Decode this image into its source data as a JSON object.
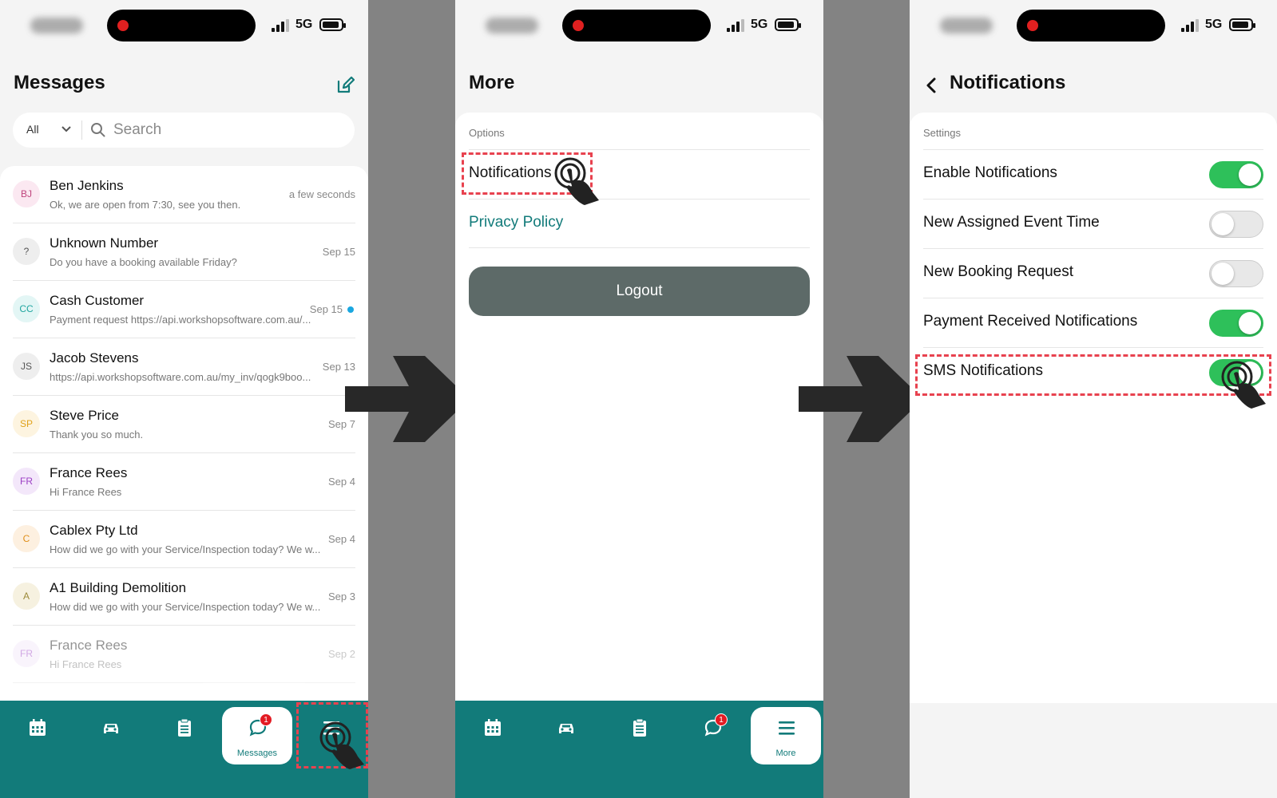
{
  "colors": {
    "teal": "#127b7a",
    "toggle_on": "#2ec05a",
    "highlight": "#e8424f",
    "badge": "#e31b23"
  },
  "status_bar": {
    "network": "5G"
  },
  "panel1": {
    "title": "Messages",
    "filter": "All",
    "search_placeholder": "Search",
    "messages": [
      {
        "initials": "BJ",
        "name": "Ben Jenkins",
        "preview": "Ok, we are open from 7:30, see you then.",
        "date": "a few seconds",
        "avatar_color": "#c0467e",
        "avatar_bg": "#fbe8f1"
      },
      {
        "initials": "?",
        "name": "Unknown Number",
        "preview": "Do you have a booking available Friday?",
        "date": "Sep 15",
        "avatar_color": "#555555",
        "avatar_bg": "#eeeeee"
      },
      {
        "initials": "CC",
        "name": "Cash Customer",
        "preview": "Payment request https://api.workshopsoftware.com.au/...",
        "date": "Sep 15",
        "avatar_color": "#21a6a0",
        "avatar_bg": "#e3f6f5",
        "unread": true
      },
      {
        "initials": "JS",
        "name": "Jacob Stevens",
        "preview": "https://api.workshopsoftware.com.au/my_inv/qogk9boo...",
        "date": "Sep 13",
        "avatar_color": "#555555",
        "avatar_bg": "#eeeeee"
      },
      {
        "initials": "SP",
        "name": "Steve Price",
        "preview": "Thank you so much.",
        "date": "Sep 7",
        "avatar_color": "#e0a21a",
        "avatar_bg": "#fdf4e0"
      },
      {
        "initials": "FR",
        "name": "France Rees",
        "preview": "Hi France Rees",
        "date": "Sep 4",
        "avatar_color": "#9b3fc4",
        "avatar_bg": "#f3e7fa"
      },
      {
        "initials": "C",
        "name": "Cablex Pty Ltd",
        "preview": "How did we go with your Service/Inspection today? We w...",
        "date": "Sep 4",
        "avatar_color": "#e08f1a",
        "avatar_bg": "#fdf0e0"
      },
      {
        "initials": "A",
        "name": "A1 Building Demolition",
        "preview": "How did we go with your Service/Inspection today? We w...",
        "date": "Sep 3",
        "avatar_color": "#9c8a3a",
        "avatar_bg": "#f6f1e0"
      },
      {
        "initials": "FR",
        "name": "France Rees",
        "preview": "Hi France Rees",
        "date": "Sep 2",
        "avatar_color": "#9b3fc4",
        "avatar_bg": "#f3e7fa",
        "faded": true
      }
    ],
    "tabs": {
      "messages_label": "Messages",
      "badge": "1"
    }
  },
  "panel2": {
    "title": "More",
    "section": "Options",
    "notifications": "Notifications",
    "privacy": "Privacy Policy",
    "logout": "Logout",
    "tabs": {
      "more_label": "More",
      "badge": "1"
    }
  },
  "panel3": {
    "title": "Notifications",
    "section": "Settings",
    "settings": [
      {
        "label": "Enable Notifications",
        "on": true
      },
      {
        "label": "New Assigned Event Time",
        "on": false
      },
      {
        "label": "New Booking Request",
        "on": false
      },
      {
        "label": "Payment Received Notifications",
        "on": true
      },
      {
        "label": "SMS Notifications",
        "on": true
      }
    ]
  }
}
